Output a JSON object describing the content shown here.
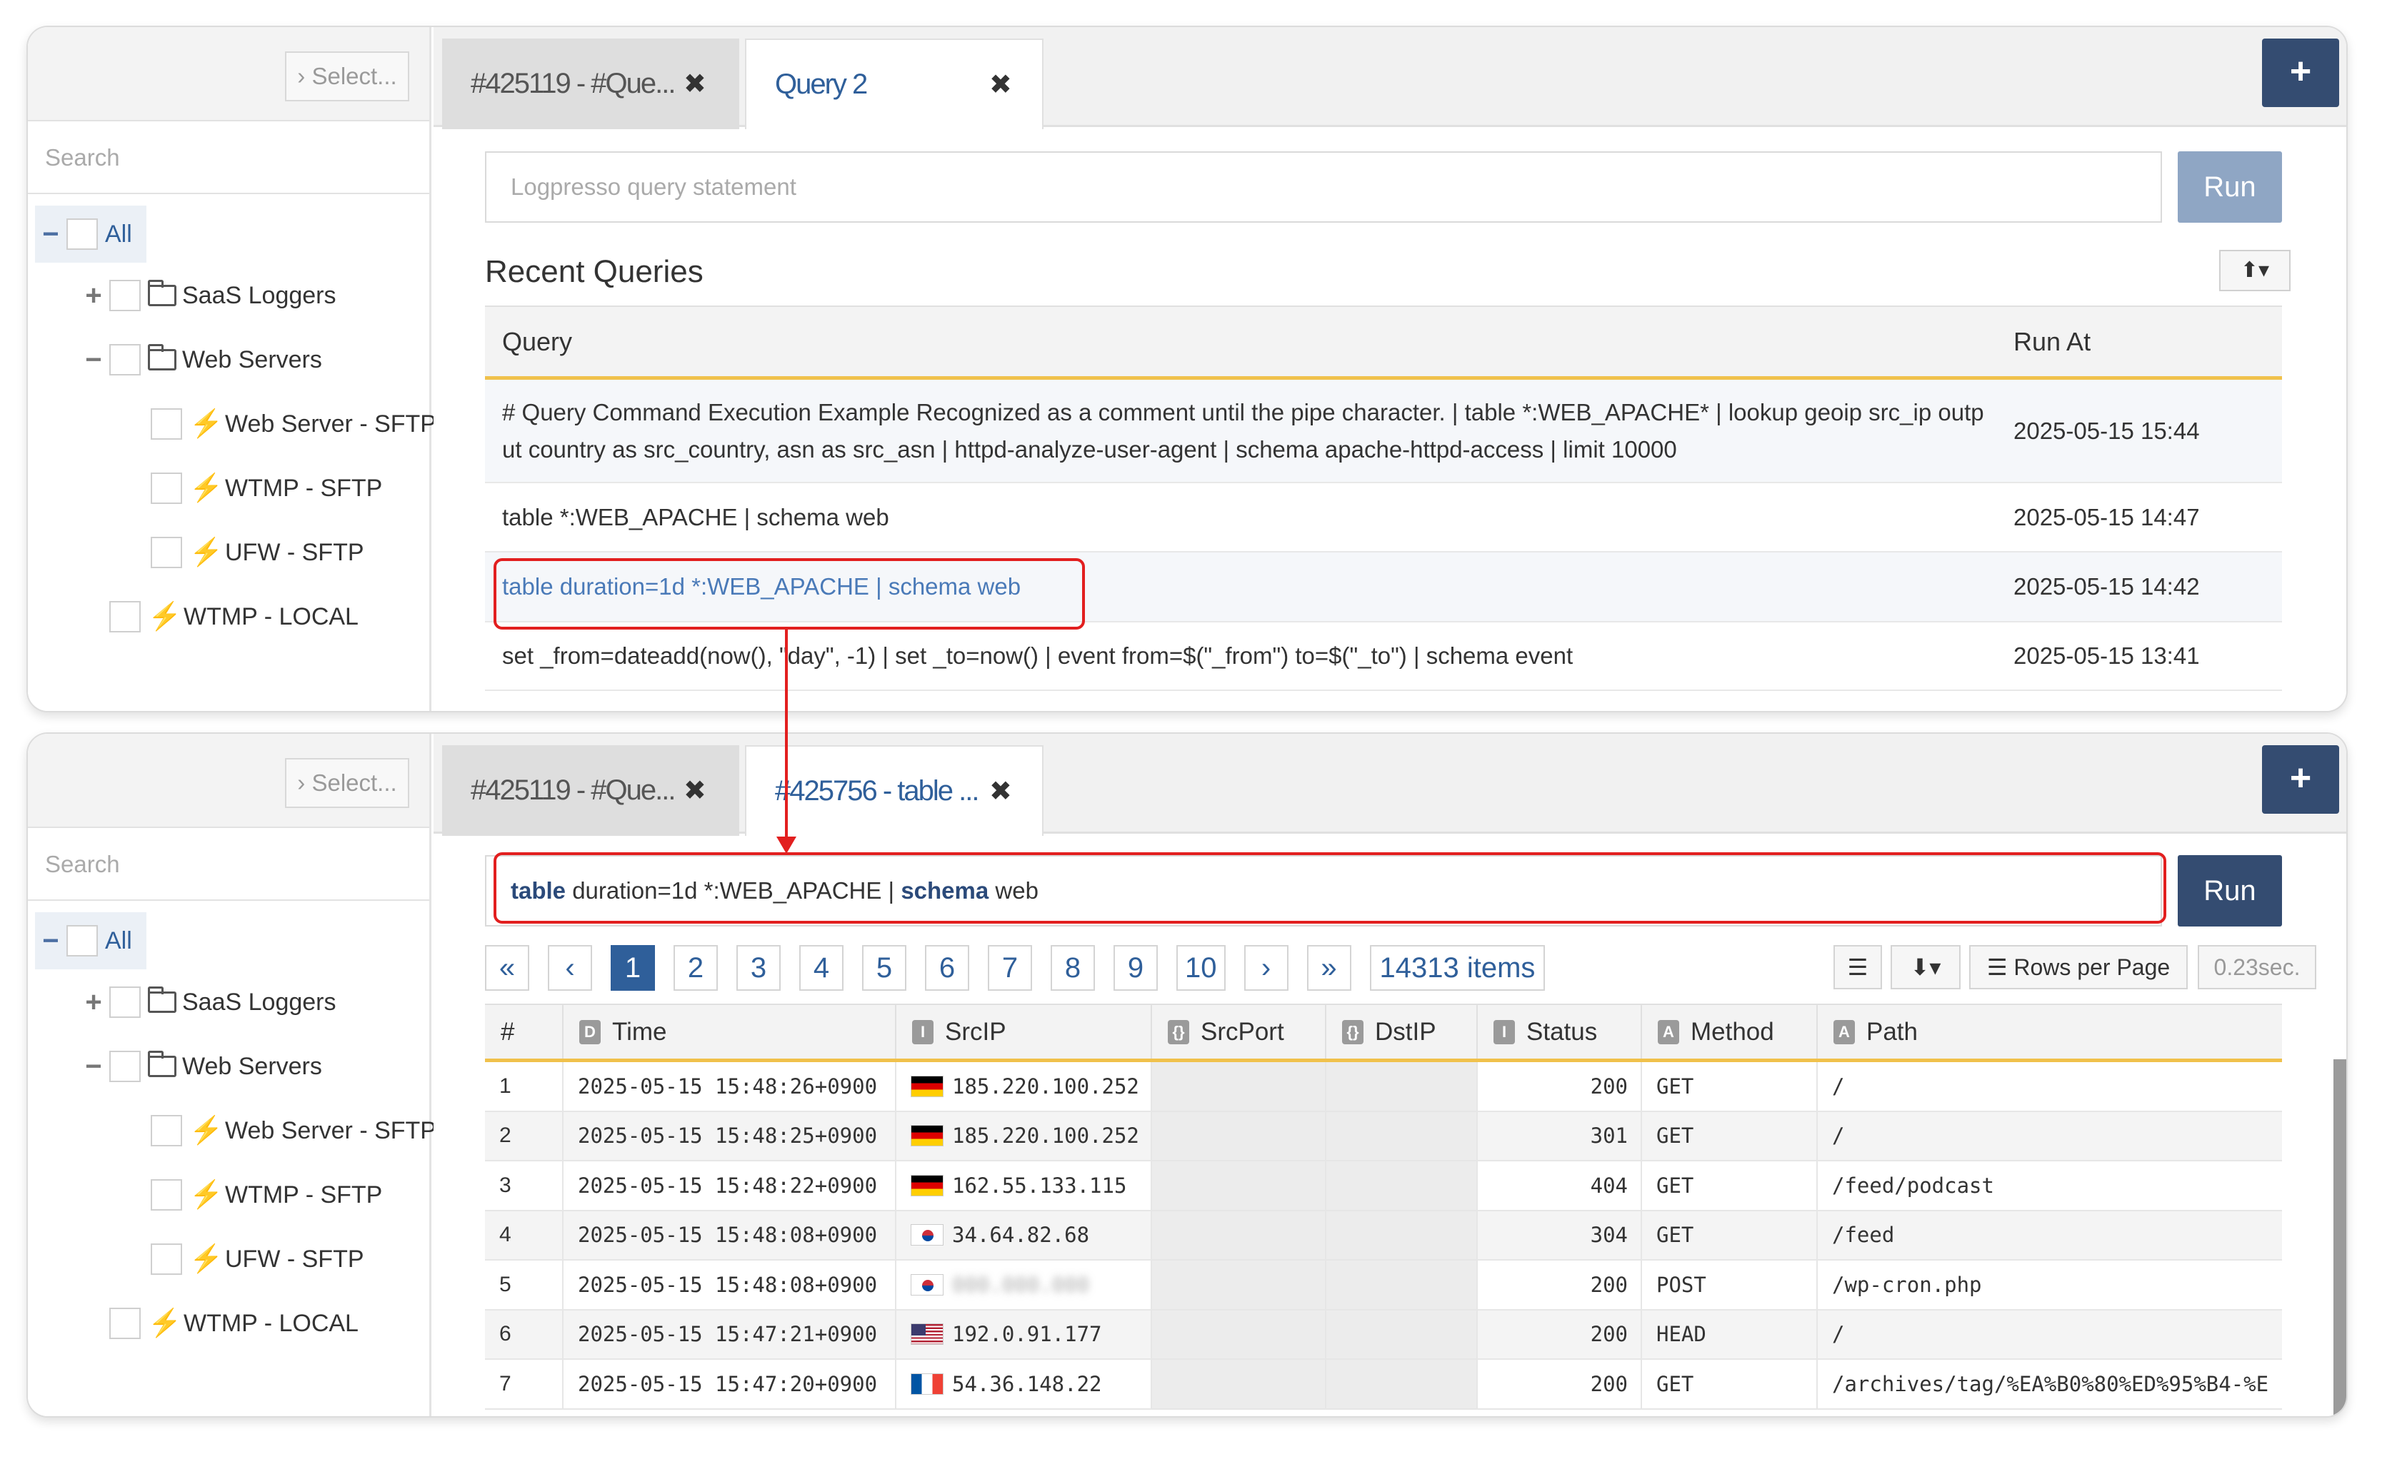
{
  "sidebar": {
    "select_label": "› Select...",
    "search_placeholder": "Search",
    "tree": {
      "all": "All",
      "saas_loggers": "SaaS Loggers",
      "web_servers": "Web Servers",
      "web_server_sftp": "Web Server - SFTP",
      "wtmp_sftp": "WTMP - SFTP",
      "ufw_sftp": "UFW - SFTP",
      "wtmp_local": "WTMP - LOCAL"
    }
  },
  "panel1": {
    "tabs": [
      {
        "label": "#425119 - #Que..."
      },
      {
        "label": "Query 2"
      }
    ],
    "query_placeholder": "Logpresso query statement",
    "run_label": "Run",
    "recent_title": "Recent Queries",
    "columns": {
      "query": "Query",
      "run_at": "Run At"
    },
    "recent": [
      {
        "query": "# Query Command Execution Example Recognized as a comment until the pipe character. | table *:WEB_APACHE* | lookup geoip src_ip output country as src_country, asn as src_asn | httpd-analyze-user-agent | schema apache-httpd-access | limit 10000",
        "run_at": "2025-05-15 15:44"
      },
      {
        "query": "table *:WEB_APACHE | schema web",
        "run_at": "2025-05-15 14:47"
      },
      {
        "query": "table duration=1d *:WEB_APACHE | schema web",
        "run_at": "2025-05-15 14:42"
      },
      {
        "query": "set _from=dateadd(now(), \"day\", -1) | set _to=now() | event from=$(\"_from\") to=$(\"_to\") | schema event",
        "run_at": "2025-05-15 13:41"
      }
    ]
  },
  "panel2": {
    "tabs": [
      {
        "label": "#425119 - #Que..."
      },
      {
        "label": "#425756 - table ..."
      }
    ],
    "query": {
      "kw1": "table",
      "mid": " duration=1d *:WEB_APACHE | ",
      "kw2": "schema",
      "tail": " web"
    },
    "run_label": "Run",
    "pager": {
      "first": "«",
      "prev": "‹",
      "next": "›",
      "last": "»",
      "pages": [
        "1",
        "2",
        "3",
        "4",
        "5",
        "6",
        "7",
        "8",
        "9",
        "10"
      ],
      "items": "14313 items"
    },
    "rows_per_page": "Rows per Page",
    "elapsed": "0.23sec.",
    "columns": [
      {
        "badge": "",
        "name": "#"
      },
      {
        "badge": "D",
        "name": "Time"
      },
      {
        "badge": "I",
        "name": "SrcIP"
      },
      {
        "badge": "{}",
        "name": "SrcPort"
      },
      {
        "badge": "{}",
        "name": "DstIP"
      },
      {
        "badge": "I",
        "name": "Status"
      },
      {
        "badge": "A",
        "name": "Method"
      },
      {
        "badge": "A",
        "name": "Path"
      }
    ],
    "rows": [
      {
        "n": "1",
        "time": "2025-05-15 15:48:26+0900",
        "flag": "de",
        "ip": "185.220.100.252",
        "status": "200",
        "method": "GET",
        "path": "/"
      },
      {
        "n": "2",
        "time": "2025-05-15 15:48:25+0900",
        "flag": "de",
        "ip": "185.220.100.252",
        "status": "301",
        "method": "GET",
        "path": "/"
      },
      {
        "n": "3",
        "time": "2025-05-15 15:48:22+0900",
        "flag": "de",
        "ip": "162.55.133.115",
        "status": "404",
        "method": "GET",
        "path": "/feed/podcast"
      },
      {
        "n": "4",
        "time": "2025-05-15 15:48:08+0900",
        "flag": "kr",
        "ip": "34.64.82.68",
        "status": "304",
        "method": "GET",
        "path": "/feed"
      },
      {
        "n": "5",
        "time": "2025-05-15 15:48:08+0900",
        "flag": "kr",
        "ip": "",
        "status": "200",
        "method": "POST",
        "path": "/wp-cron.php"
      },
      {
        "n": "6",
        "time": "2025-05-15 15:47:21+0900",
        "flag": "us",
        "ip": "192.0.91.177",
        "status": "200",
        "method": "HEAD",
        "path": "/"
      },
      {
        "n": "7",
        "time": "2025-05-15 15:47:20+0900",
        "flag": "fr",
        "ip": "54.36.148.22",
        "status": "200",
        "method": "GET",
        "path": "/archives/tag/%EA%B0%80%ED%95%B4-%E"
      }
    ]
  },
  "colors": {
    "accent": "#2f5f9a",
    "run_active": "#344c71",
    "run_disabled": "#8fa6c4",
    "highlight": "#e21f1f",
    "header_border": "#f0c14b"
  }
}
